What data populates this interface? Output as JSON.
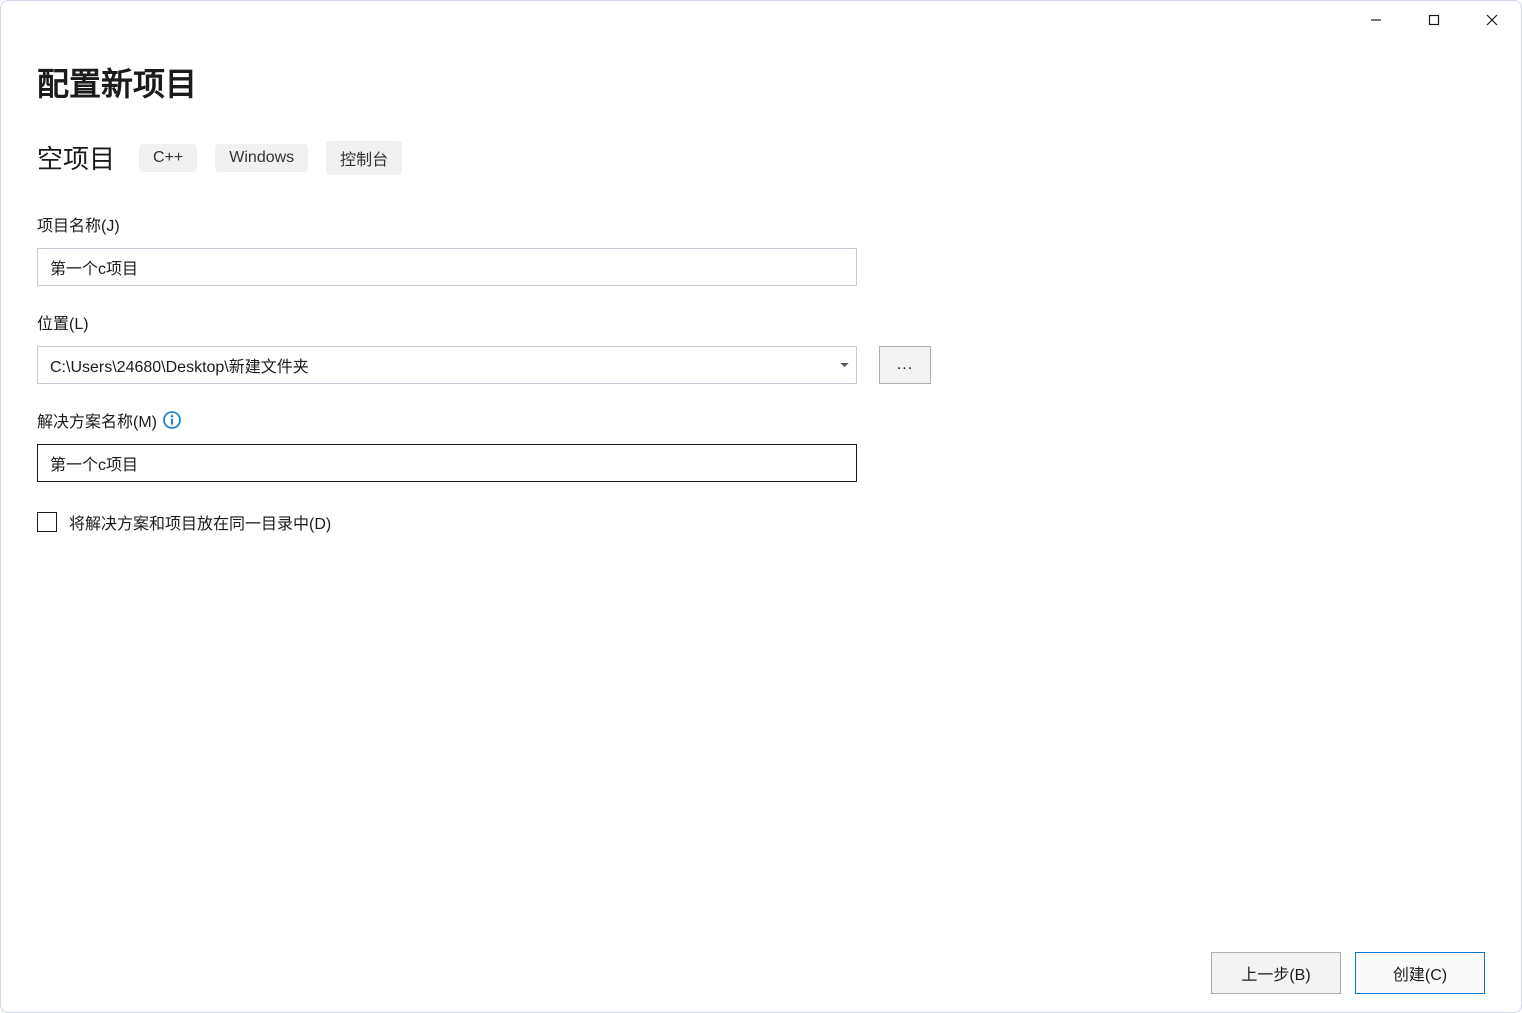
{
  "header": {
    "title": "配置新项目"
  },
  "subtitle": {
    "text": "空项目",
    "tags": [
      "C++",
      "Windows",
      "控制台"
    ]
  },
  "fields": {
    "projectName": {
      "label": "项目名称(J)",
      "value": "第一个c项目"
    },
    "location": {
      "label": "位置(L)",
      "value": "C:\\Users\\24680\\Desktop\\新建文件夹",
      "browse_label": "..."
    },
    "solutionName": {
      "label": "解决方案名称(M)",
      "value": "第一个c项目"
    },
    "sameDirectory": {
      "label": "将解决方案和项目放在同一目录中(D)",
      "checked": false
    }
  },
  "footer": {
    "back": "上一步(B)",
    "create": "创建(C)"
  }
}
